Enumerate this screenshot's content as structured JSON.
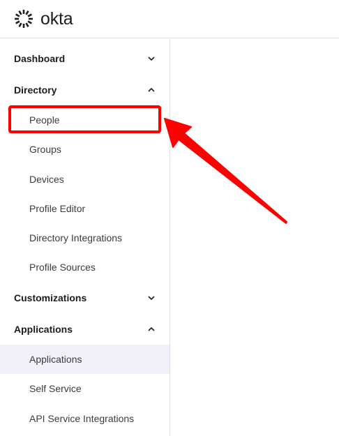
{
  "brand": {
    "name": "okta"
  },
  "sidebar": {
    "sections": [
      {
        "label": "Dashboard",
        "expanded": false
      },
      {
        "label": "Directory",
        "expanded": true
      },
      {
        "label": "Customizations",
        "expanded": false
      },
      {
        "label": "Applications",
        "expanded": true
      }
    ],
    "directory_items": [
      {
        "label": "People"
      },
      {
        "label": "Groups"
      },
      {
        "label": "Devices"
      },
      {
        "label": "Profile Editor"
      },
      {
        "label": "Directory Integrations"
      },
      {
        "label": "Profile Sources"
      }
    ],
    "applications_items": [
      {
        "label": "Applications",
        "active": true
      },
      {
        "label": "Self Service"
      },
      {
        "label": "API Service Integrations"
      }
    ]
  },
  "annotation": {
    "color": "#ff0000",
    "target": "People"
  },
  "icons": {
    "chevron_down": "chevron-down-icon",
    "chevron_up": "chevron-up-icon",
    "logo": "okta-sunburst-icon"
  }
}
